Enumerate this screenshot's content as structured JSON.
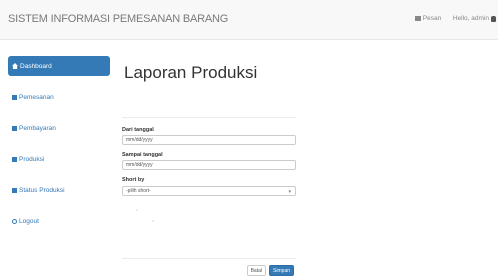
{
  "app_title": "SISTEM INFORMASI PEMESANAN BARANG",
  "topbar": {
    "messages_label": "Pesan",
    "greeting": "Hello, admin"
  },
  "sidebar": {
    "items": [
      {
        "label": "Dashboard",
        "icon": "home-icon",
        "active": true
      },
      {
        "label": "Pemesanan",
        "icon": "building-icon",
        "active": false
      },
      {
        "label": "Pembayaran",
        "icon": "building-icon",
        "active": false
      },
      {
        "label": "Produksi",
        "icon": "building-icon",
        "active": false
      },
      {
        "label": "Status Produksi",
        "icon": "building-icon",
        "active": false
      },
      {
        "label": "Logout",
        "icon": "logout-icon",
        "active": false
      }
    ]
  },
  "page_title": "Laporan Produksi",
  "form": {
    "from_date": {
      "label": "Dari tanggal",
      "placeholder": "mm/dd/yyyy"
    },
    "to_date": {
      "label": "Sampai tanggal",
      "placeholder": "mm/dd/yyyy"
    },
    "sort_by": {
      "label": "Short by",
      "value": "-pilih short-"
    }
  },
  "buttons": {
    "cancel": "Batal",
    "submit": "Simpan"
  },
  "colors": {
    "accent": "#337ab7",
    "topbar_bg": "#f8f8f8"
  }
}
